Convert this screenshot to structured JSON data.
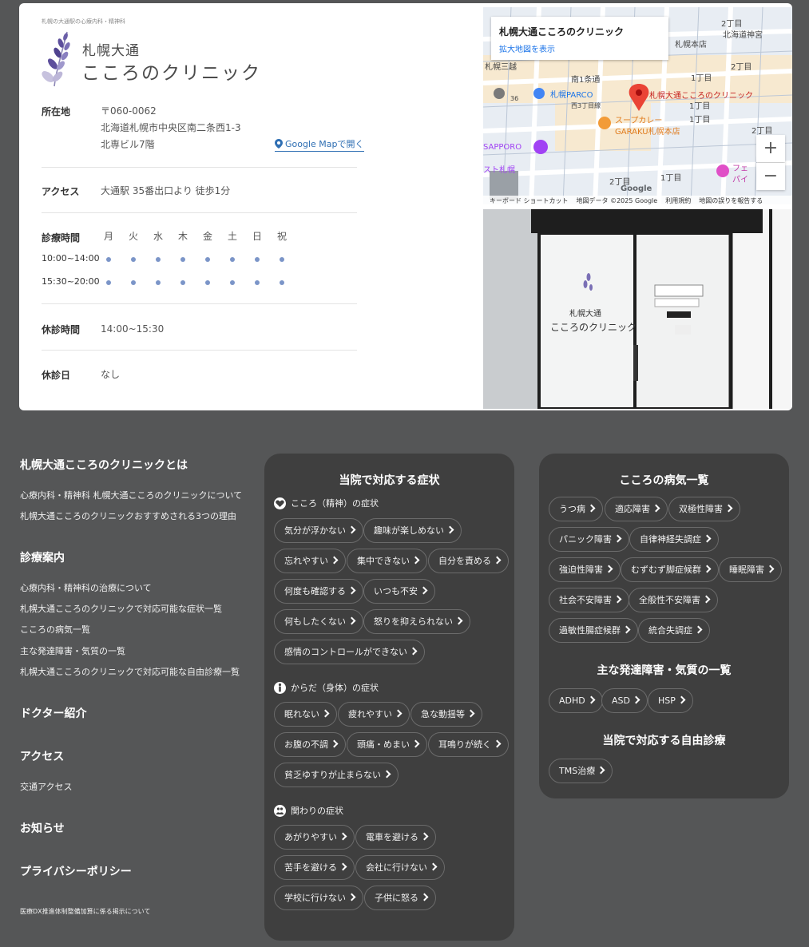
{
  "card": {
    "tagline": "札幌の大通駅の心療内科・精神科",
    "logo_line1": "札幌大通",
    "logo_line2": "こころのクリニック",
    "address_label": "所在地",
    "address": [
      "〒060-0062",
      "北海道札幌市中央区南二条西1-3",
      "北専ビル7階"
    ],
    "gmap_link": "Google Mapで開く",
    "access_label": "アクセス",
    "access": "大通駅 35番出口より 徒歩1分",
    "hours_label": "診療時間",
    "days": [
      "月",
      "火",
      "水",
      "木",
      "金",
      "土",
      "日",
      "祝"
    ],
    "slots": [
      {
        "time": "10:00~14:00",
        "open": [
          true,
          true,
          true,
          true,
          true,
          true,
          true,
          true
        ]
      },
      {
        "time": "15:30~20:00",
        "open": [
          true,
          true,
          true,
          true,
          true,
          true,
          true,
          true
        ]
      }
    ],
    "break_label": "休診時間",
    "break_value": "14:00~15:30",
    "closed_label": "休診日",
    "closed_value": "なし"
  },
  "map": {
    "popup_title": "札幌大通こころのクリニック",
    "popup_link": "拡大地図を表示",
    "pin_label": "札幌大通こころのクリニック",
    "labels": {
      "l1": "2丁目",
      "l2": "北海道神宮",
      "l3": "札幌本店",
      "l4": "南1条通",
      "l5": "札幌PARCO",
      "l6": "1丁目",
      "l7": "スープカレー",
      "l8": "GARAKU札幌本店",
      "l9": "SAPPORO",
      "l10": "スト札幌",
      "l11": "フェ",
      "l12": "パイ",
      "l13": "2丁目",
      "l14": "1丁目",
      "l15": "Google",
      "l16": "札幌三越",
      "l17": "2丁目",
      "l18": "1丁目",
      "l19": "1丁目",
      "l20": "2丁目",
      "l21": "西3丁目線",
      "l22": "36"
    },
    "zoom_in": "+",
    "zoom_out": "−",
    "footer": [
      "キーボード ショートカット",
      "地図データ ©2025 Google",
      "利用規約",
      "地図の誤りを報告する"
    ]
  },
  "photo": {
    "sign_line1": "札幌大通",
    "sign_line2": "こころのクリニック"
  },
  "footer_nav": {
    "about_title": "札幌大通こころのクリニックとは",
    "about_links": [
      "心療内科・精神科 札幌大通こころのクリニックについて",
      "札幌大通こころのクリニックおすすめされる3つの理由"
    ],
    "guide_title": "診療案内",
    "guide_links": [
      "心療内科・精神科の治療について",
      "札幌大通こころのクリニックで対応可能な症状一覧",
      "こころの病気一覧",
      "主な発達障害・気質の一覧",
      "札幌大通こころのクリニックで対応可能な自由診療一覧"
    ],
    "doctor_title": "ドクター紹介",
    "access_title": "アクセス",
    "access_links": [
      "交通アクセス"
    ],
    "news_title": "お知らせ",
    "privacy_title": "プライバシーポリシー",
    "dx_link": "医療DX推進体制整備加算に係る掲示について"
  },
  "symptoms": {
    "title": "当院で対応する症状",
    "mind_title": "こころ（精神）の症状",
    "mind": [
      "気分が浮かない",
      "趣味が楽しめない",
      "忘れやすい",
      "集中できない",
      "自分を責める",
      "何度も確認する",
      "いつも不安",
      "何もしたくない",
      "怒りを抑えられない",
      "感情のコントロールができない"
    ],
    "body_title": "からだ（身体）の症状",
    "body": [
      "眠れない",
      "疲れやすい",
      "急な動揺等",
      "お腹の不調",
      "頭痛・めまい",
      "耳鳴りが続く",
      "貧乏ゆすりが止まらない"
    ],
    "rel_title": "関わりの症状",
    "rel": [
      "あがりやすい",
      "電車を避ける",
      "苦手を避ける",
      "会社に行けない",
      "学校に行けない",
      "子供に怒る"
    ]
  },
  "diseases": {
    "title": "こころの病気一覧",
    "items": [
      "うつ病",
      "適応障害",
      "双極性障害",
      "パニック障害",
      "自律神経失調症",
      "強迫性障害",
      "むずむず脚症候群",
      "睡眠障害",
      "社会不安障害",
      "全般性不安障害",
      "過敏性腸症候群",
      "統合失調症"
    ],
    "dev_title": "主な発達障害・気質の一覧",
    "dev": [
      "ADHD",
      "ASD",
      "HSP"
    ],
    "free_title": "当院で対応する自由診療",
    "free": [
      "TMS治療"
    ]
  }
}
